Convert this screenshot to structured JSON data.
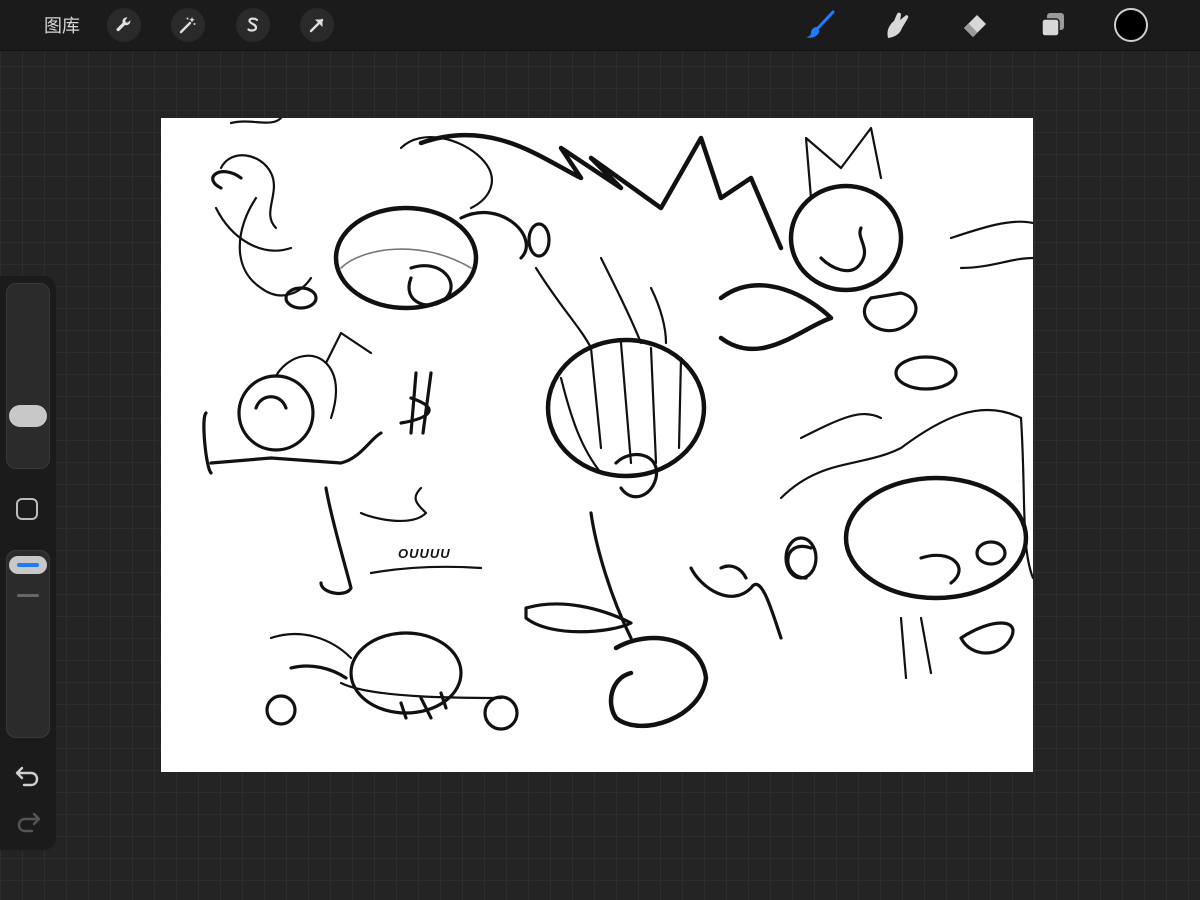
{
  "toolbar": {
    "gallery_label": "图库",
    "left_tools": [
      "wrench-icon",
      "magic-wand-icon",
      "selection-s-icon",
      "transform-arrow-icon"
    ],
    "right_tools": [
      "brush-icon",
      "smudge-icon",
      "eraser-icon",
      "layers-icon"
    ],
    "active_tool": "brush-icon",
    "accent_color": "#1f7bff",
    "current_color": "#000000"
  },
  "sidebar": {
    "controls": [
      "brush-size-slider",
      "modify-button",
      "opacity-slider",
      "undo-icon",
      "redo-icon"
    ]
  },
  "canvas": {
    "sketch_text": "OUUUU",
    "background": "#ffffff"
  }
}
